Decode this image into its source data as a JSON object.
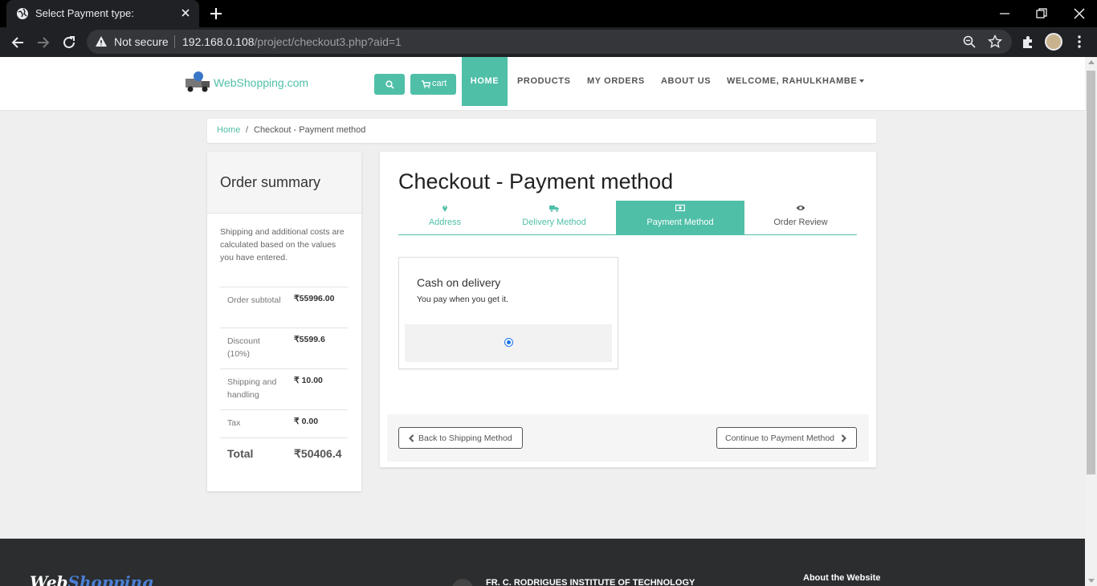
{
  "browser": {
    "tab_title": "Select Payment type:",
    "not_secure_label": "Not secure",
    "url_host": "192.168.0.108",
    "url_path": "/project/checkout3.php?aid=1"
  },
  "navbar": {
    "logo_text": "WebShopping.com",
    "cart_label": "cart",
    "items": [
      {
        "label": "HOME"
      },
      {
        "label": "PRODUCTS"
      },
      {
        "label": "MY ORDERS"
      },
      {
        "label": "ABOUT US"
      },
      {
        "label": "WELCOME, RAHULKHAMBE"
      }
    ]
  },
  "breadcrumb": {
    "home": "Home",
    "separator": "/",
    "current": "Checkout - Payment method"
  },
  "summary": {
    "title": "Order summary",
    "note": "Shipping and additional costs are calculated based on the values you have entered.",
    "rows": [
      {
        "label": "Order subtotal",
        "value": "₹55996.00"
      },
      {
        "label": "Discount (10%)",
        "value": "₹5599.6"
      },
      {
        "label": "Shipping and handling",
        "value": "₹ 10.00"
      },
      {
        "label": "Tax",
        "value": "₹ 0.00"
      },
      {
        "label": "Total",
        "value": "₹50406.4"
      }
    ]
  },
  "checkout": {
    "title": "Checkout - Payment method",
    "steps": [
      {
        "label": "Address",
        "icon": "map-marker-icon"
      },
      {
        "label": "Delivery Method",
        "icon": "truck-icon"
      },
      {
        "label": "Payment Method",
        "icon": "money-icon"
      },
      {
        "label": "Order Review",
        "icon": "eye-icon"
      }
    ],
    "payment_option": {
      "title": "Cash on delivery",
      "description": "You pay when you get it.",
      "selected": true
    },
    "back_button": "Back to Shipping Method",
    "continue_button": "Continue to Payment Method"
  },
  "footer": {
    "logo_part1": "Web",
    "logo_part2": "Shopping",
    "institute": "FR. C. RODRIGUES INSTITUTE OF TECHNOLOGY",
    "about": "About the Website"
  },
  "colors": {
    "accent": "#4fbfa8",
    "footer_bg": "#2c2d2f"
  }
}
